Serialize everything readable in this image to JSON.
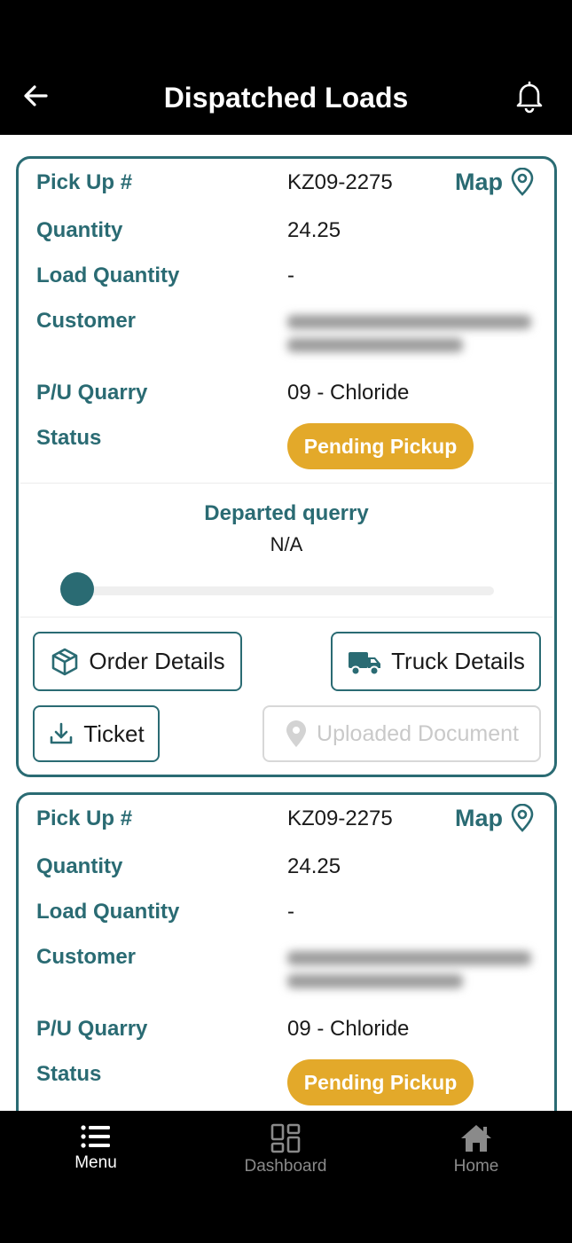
{
  "header": {
    "title": "Dispatched Loads",
    "back_icon": "arrow-left-icon",
    "bell_icon": "bell-icon"
  },
  "loads": [
    {
      "pickup_label": "Pick Up #",
      "pickup_value": "KZ09-2275",
      "map_label": "Map",
      "quantity_label": "Quantity",
      "quantity_value": "24.25",
      "load_quantity_label": "Load Quantity",
      "load_quantity_value": "-",
      "customer_label": "Customer",
      "quarry_label": "P/U Quarry",
      "quarry_value": "09 - Chloride",
      "status_label": "Status",
      "status_value": "Pending Pickup",
      "departed_label": "Departed querry",
      "departed_value": "N/A",
      "progress": 0,
      "order_details_label": "Order Details",
      "truck_details_label": "Truck Details",
      "ticket_label": "Ticket",
      "uploaded_document_label": "Uploaded Document"
    },
    {
      "pickup_label": "Pick Up #",
      "pickup_value": "KZ09-2275",
      "map_label": "Map",
      "quantity_label": "Quantity",
      "quantity_value": "24.25",
      "load_quantity_label": "Load Quantity",
      "load_quantity_value": "-",
      "customer_label": "Customer",
      "quarry_label": "P/U Quarry",
      "quarry_value": "09 - Chloride",
      "status_label": "Status",
      "status_value": "Pending Pickup"
    }
  ],
  "bottom_nav": [
    {
      "label": "Menu",
      "icon": "menu-list-icon",
      "active": true
    },
    {
      "label": "Dashboard",
      "icon": "dashboard-grid-icon",
      "active": false
    },
    {
      "label": "Home",
      "icon": "home-icon",
      "active": false
    }
  ],
  "colors": {
    "accent": "#2a6b73",
    "status_pending": "#e3a92a",
    "background": "#ffffff",
    "bar": "#000000"
  }
}
